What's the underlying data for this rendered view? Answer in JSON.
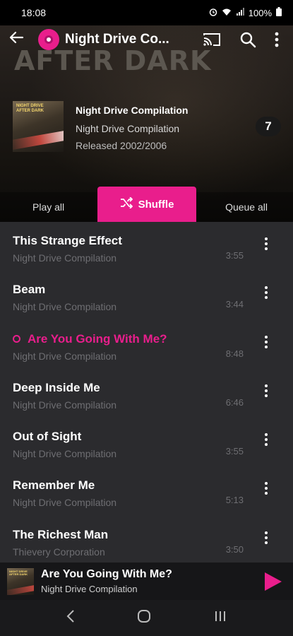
{
  "status": {
    "time": "18:08",
    "battery": "100%"
  },
  "app_bar": {
    "title": "Night Drive Co...",
    "back_icon": "arrow-left-icon",
    "cast_icon": "cast-icon",
    "search_icon": "search-icon",
    "more_icon": "more-vert-icon"
  },
  "header": {
    "big_title": "AFTER DARK"
  },
  "album": {
    "cover_text_line1": "NIGHT DRIVE",
    "cover_text_line2": "AFTER DARK",
    "name": "Night Drive Compilation",
    "artist": "Night Drive Compilation",
    "released": "Released 2002/2006",
    "track_count": "7"
  },
  "controls": {
    "play_all": "Play all",
    "shuffle": "Shuffle",
    "queue_all": "Queue all"
  },
  "tracks": [
    {
      "title": "This Strange Effect",
      "artist": "Night Drive Compilation",
      "duration": "3:55",
      "active": false
    },
    {
      "title": "Beam",
      "artist": "Night Drive Compilation",
      "duration": "3:44",
      "active": false
    },
    {
      "title": "Are You Going With Me?",
      "artist": "Night Drive Compilation",
      "duration": "8:48",
      "active": true
    },
    {
      "title": "Deep Inside Me",
      "artist": "Night Drive Compilation",
      "duration": "6:46",
      "active": false
    },
    {
      "title": "Out of Sight",
      "artist": "Night Drive Compilation",
      "duration": "3:55",
      "active": false
    },
    {
      "title": "Remember Me",
      "artist": "Night Drive Compilation",
      "duration": "5:13",
      "active": false
    },
    {
      "title": "The Richest Man",
      "artist": "Thievery Corporation",
      "duration": "3:50",
      "active": false
    }
  ],
  "mini_player": {
    "title": "Are You Going With Me?",
    "artist": "Night Drive Compilation"
  },
  "colors": {
    "accent": "#e91e8c",
    "list_bg": "#2b2b2e"
  }
}
